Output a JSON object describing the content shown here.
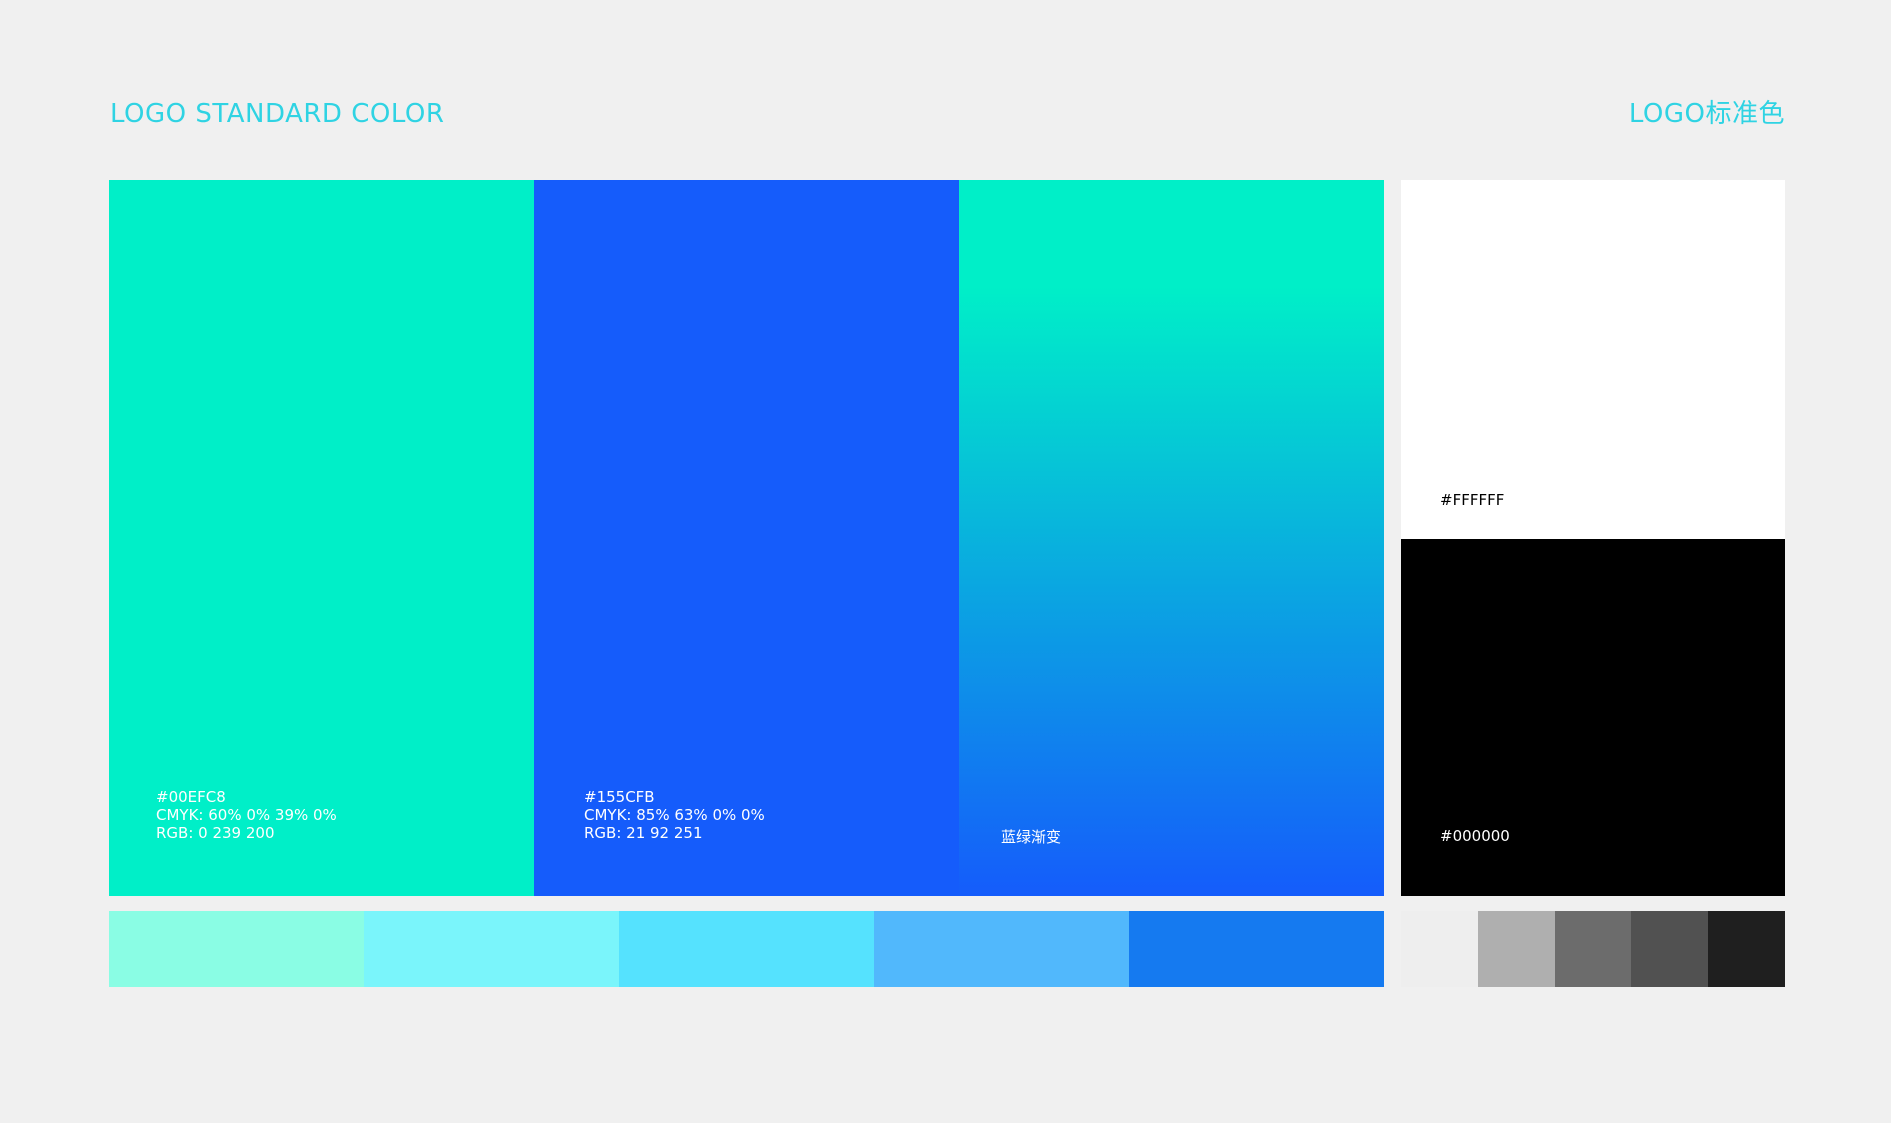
{
  "header": {
    "left_title": "LOGO STANDARD COLOR",
    "right_title": "LOGO标准色"
  },
  "colors": {
    "accent_heading": "#2fd3e3",
    "page_background": "#f0f0f0"
  },
  "swatches": [
    {
      "color": "#00EFC8",
      "hex": "#00EFC8",
      "cmyk": "CMYK: 60%  0%  39%  0%",
      "rgb": "RGB: 0   239   200"
    },
    {
      "color": "#155CFB",
      "hex": "#155CFB",
      "cmyk": "CMYK: 85%  63%  0%  0%",
      "rgb": "RGB: 21   92   251"
    },
    {
      "gradient_from": "#00EFC8",
      "gradient_to": "#155CFB",
      "label": "蓝绿渐变"
    }
  ],
  "mono": {
    "white": {
      "color": "#FFFFFF",
      "label": "#FFFFFF"
    },
    "black": {
      "color": "#000000",
      "label": "#000000"
    }
  },
  "tints": [
    "#8AFDE4",
    "#7AF5FB",
    "#55E2FE",
    "#51B8FC",
    "#157AF0"
  ],
  "grays": [
    "#EEEEEE",
    "#AFAFAF",
    "#6C6C6C",
    "#515151",
    "#1F1F1F"
  ]
}
